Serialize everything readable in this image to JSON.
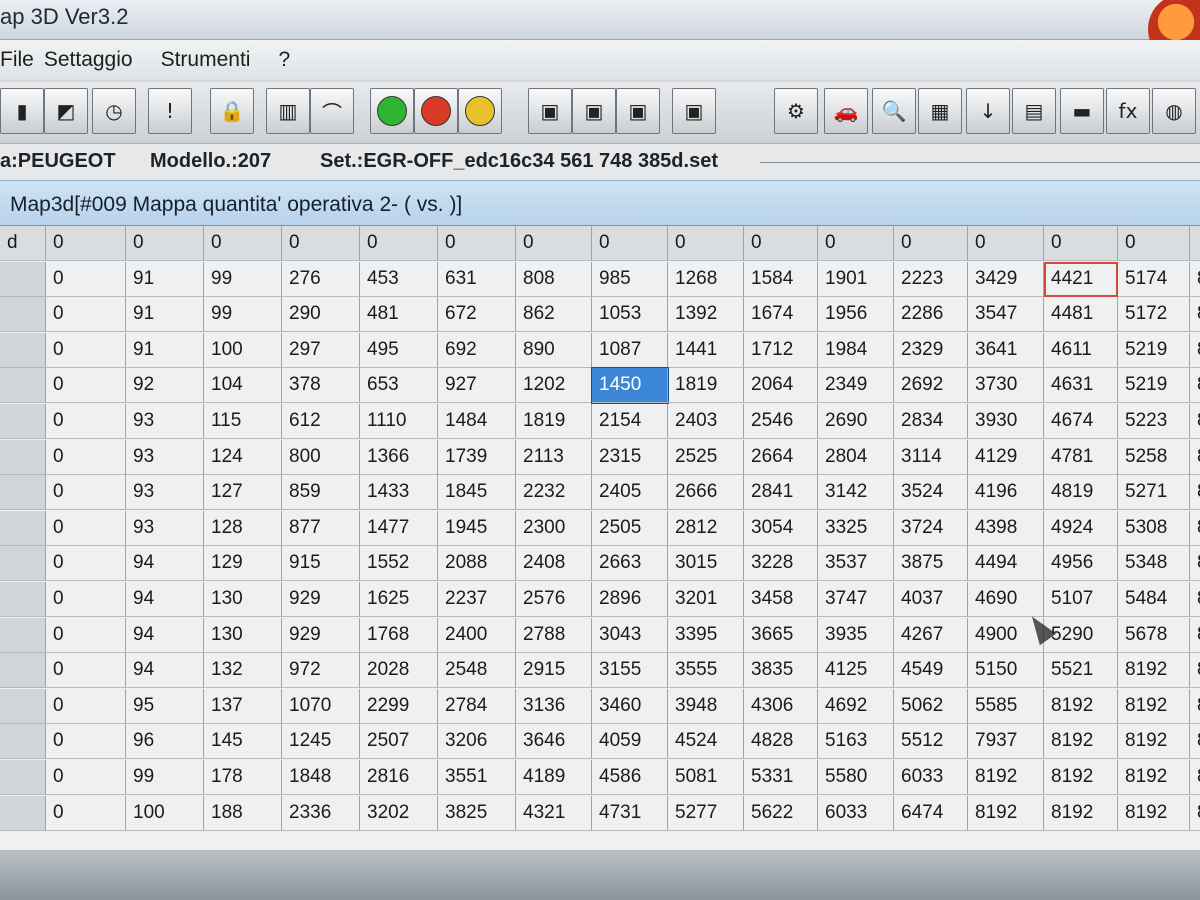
{
  "window": {
    "title": "ap 3D Ver3.2"
  },
  "menu": [
    "File",
    "Settaggio",
    "Strumenti",
    "?"
  ],
  "toolbar": [
    {
      "name": "save-icon",
      "glyph": "▮"
    },
    {
      "name": "folder-icon",
      "glyph": "◩"
    },
    {
      "name": "clock-icon",
      "glyph": "◷"
    },
    {
      "name": "warning-icon",
      "glyph": "!"
    },
    {
      "name": "lock-icon",
      "glyph": "🔒"
    },
    {
      "name": "grid-icon",
      "glyph": "▥"
    },
    {
      "name": "graph-icon",
      "glyph": "⌒"
    },
    {
      "name": "green-dot-icon",
      "glyph": "",
      "color": "#2fb52f"
    },
    {
      "name": "red-dot-icon",
      "glyph": "",
      "color": "#d93a25"
    },
    {
      "name": "yellow-dot-icon",
      "glyph": "",
      "color": "#e8c12a"
    },
    {
      "name": "green-chip-icon",
      "glyph": "▣"
    },
    {
      "name": "red-chip-icon",
      "glyph": "▣"
    },
    {
      "name": "yellow-chip-icon",
      "glyph": "▣"
    },
    {
      "name": "chip-icon",
      "glyph": "▣"
    },
    {
      "name": "gears-icon",
      "glyph": "⚙"
    },
    {
      "name": "car-icon",
      "glyph": "🚗"
    },
    {
      "name": "magnifier-icon",
      "glyph": "🔍"
    },
    {
      "name": "memory-icon",
      "glyph": "▦"
    },
    {
      "name": "arrow-down-icon",
      "glyph": "↓"
    },
    {
      "name": "notepad-icon",
      "glyph": "▤"
    },
    {
      "name": "battery-icon",
      "glyph": "▬"
    },
    {
      "name": "function-icon",
      "glyph": "fx"
    },
    {
      "name": "globe-icon",
      "glyph": "◍"
    }
  ],
  "info": {
    "marca": "a:PEUGEOT",
    "modello": "Modello.:207",
    "set": "Set.:EGR-OFF_edc16c34 561 748 385d.set"
  },
  "map": {
    "title": "Map3d[#009 Mappa quantita' operativa 2-  ( vs. )]",
    "corner": "d",
    "columns": [
      "0",
      "0",
      "0",
      "0",
      "0",
      "0",
      "0",
      "0",
      "0",
      "0",
      "0",
      "0",
      "0",
      "0",
      "0",
      ""
    ],
    "rows": [
      [
        "0",
        "91",
        "99",
        "276",
        "453",
        "631",
        "808",
        "985",
        "1268",
        "1584",
        "1901",
        "2223",
        "3429",
        "4421",
        "5174",
        "8"
      ],
      [
        "0",
        "91",
        "99",
        "290",
        "481",
        "672",
        "862",
        "1053",
        "1392",
        "1674",
        "1956",
        "2286",
        "3547",
        "4481",
        "5172",
        "8"
      ],
      [
        "0",
        "91",
        "100",
        "297",
        "495",
        "692",
        "890",
        "1087",
        "1441",
        "1712",
        "1984",
        "2329",
        "3641",
        "4611",
        "5219",
        "8"
      ],
      [
        "0",
        "92",
        "104",
        "378",
        "653",
        "927",
        "1202",
        "1450",
        "1819",
        "2064",
        "2349",
        "2692",
        "3730",
        "4631",
        "5219",
        "8"
      ],
      [
        "0",
        "93",
        "115",
        "612",
        "1110",
        "1484",
        "1819",
        "2154",
        "2403",
        "2546",
        "2690",
        "2834",
        "3930",
        "4674",
        "5223",
        "8"
      ],
      [
        "0",
        "93",
        "124",
        "800",
        "1366",
        "1739",
        "2113",
        "2315",
        "2525",
        "2664",
        "2804",
        "3114",
        "4129",
        "4781",
        "5258",
        "8"
      ],
      [
        "0",
        "93",
        "127",
        "859",
        "1433",
        "1845",
        "2232",
        "2405",
        "2666",
        "2841",
        "3142",
        "3524",
        "4196",
        "4819",
        "5271",
        "8"
      ],
      [
        "0",
        "93",
        "128",
        "877",
        "1477",
        "1945",
        "2300",
        "2505",
        "2812",
        "3054",
        "3325",
        "3724",
        "4398",
        "4924",
        "5308",
        "8"
      ],
      [
        "0",
        "94",
        "129",
        "915",
        "1552",
        "2088",
        "2408",
        "2663",
        "3015",
        "3228",
        "3537",
        "3875",
        "4494",
        "4956",
        "5348",
        "8"
      ],
      [
        "0",
        "94",
        "130",
        "929",
        "1625",
        "2237",
        "2576",
        "2896",
        "3201",
        "3458",
        "3747",
        "4037",
        "4690",
        "5107",
        "5484",
        "8"
      ],
      [
        "0",
        "94",
        "130",
        "929",
        "1768",
        "2400",
        "2788",
        "3043",
        "3395",
        "3665",
        "3935",
        "4267",
        "4900",
        "5290",
        "5678",
        "8"
      ],
      [
        "0",
        "94",
        "132",
        "972",
        "2028",
        "2548",
        "2915",
        "3155",
        "3555",
        "3835",
        "4125",
        "4549",
        "5150",
        "5521",
        "8192",
        "8"
      ],
      [
        "0",
        "95",
        "137",
        "1070",
        "2299",
        "2784",
        "3136",
        "3460",
        "3948",
        "4306",
        "4692",
        "5062",
        "5585",
        "8192",
        "8192",
        "8"
      ],
      [
        "0",
        "96",
        "145",
        "1245",
        "2507",
        "3206",
        "3646",
        "4059",
        "4524",
        "4828",
        "5163",
        "5512",
        "7937",
        "8192",
        "8192",
        "8"
      ],
      [
        "0",
        "99",
        "178",
        "1848",
        "2816",
        "3551",
        "4189",
        "4586",
        "5081",
        "5331",
        "5580",
        "6033",
        "8192",
        "8192",
        "8192",
        "8"
      ],
      [
        "0",
        "100",
        "188",
        "2336",
        "3202",
        "3825",
        "4321",
        "4731",
        "5277",
        "5622",
        "6033",
        "6474",
        "8192",
        "8192",
        "8192",
        "8"
      ]
    ],
    "selected": {
      "row": 3,
      "col": 7
    },
    "focused": {
      "row": 0,
      "col": 13
    }
  }
}
